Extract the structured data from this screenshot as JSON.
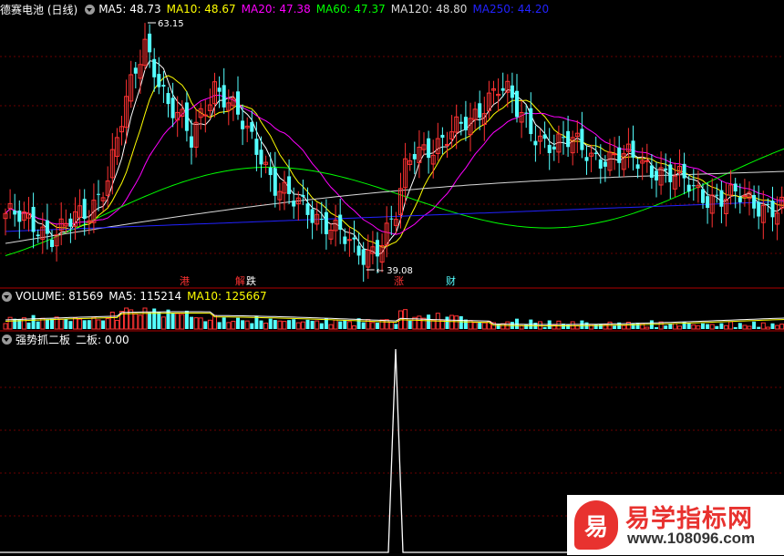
{
  "colors": {
    "up": "#ff3232",
    "down": "#54ffff",
    "ma5": "#ffffff",
    "ma10": "#ffff00",
    "ma20": "#ff00ff",
    "ma60": "#00ff00",
    "ma120": "#d8d8d8",
    "ma250": "#2222ff"
  },
  "main_panel": {
    "title": "德赛电池 (日线)",
    "ma5": "MA5: 48.73",
    "ma10": "MA10: 48.67",
    "ma20": "MA20: 47.38",
    "ma60": "MA60: 47.37",
    "ma120": "MA120: 48.80",
    "ma250": "MA250: 44.20",
    "high_label": "63.15",
    "low_label": "39.08",
    "event_labels": [
      "港",
      "解",
      "跌",
      "涨",
      "财"
    ]
  },
  "volume_panel": {
    "label": "VOLUME: 81569",
    "ma5": "MA5: 115214",
    "ma10": "MA10: 125667"
  },
  "indicator_panel": {
    "label": "强势抓二板",
    "value": "二板: 0.00"
  },
  "watermark": {
    "logo": "易",
    "title": "易学指标网",
    "url": "www.108096.com"
  },
  "chart_data": {
    "type": "candlestick",
    "price_range": [
      39.08,
      63.15
    ],
    "candles_approx": "about 140 daily candles; price rises from ~44 to a peak of 63.15, falls to a low of 39.08, recovers to ~58, then drifts down to ~45",
    "last_close": 48.73,
    "indicator_signal": "single spike in the 强势抓二板 indicator near the price low"
  }
}
